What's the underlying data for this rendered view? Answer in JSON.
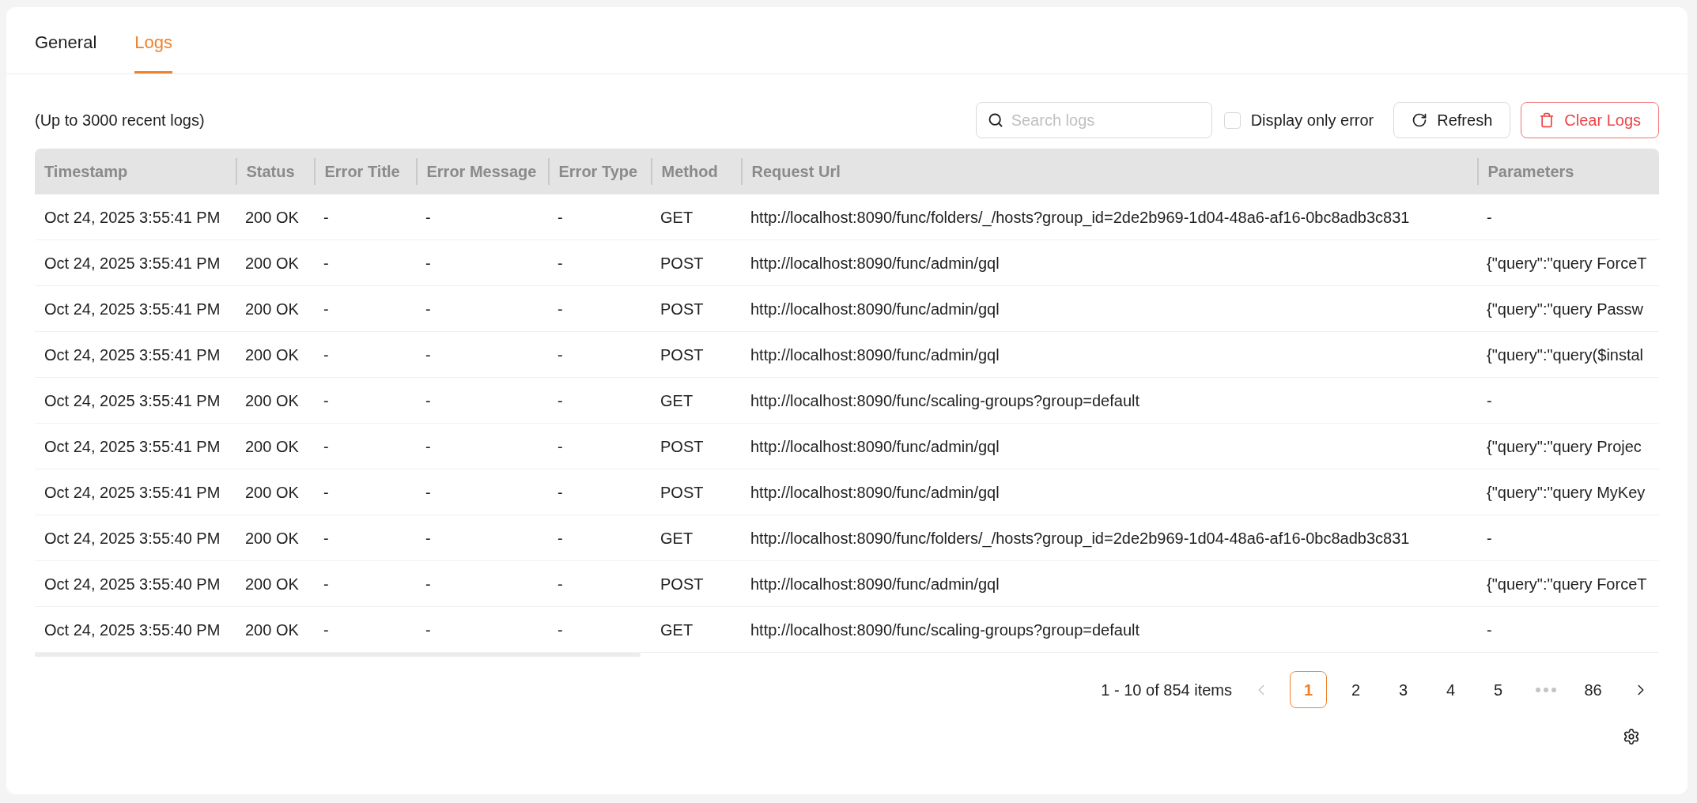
{
  "tabs": [
    {
      "label": "General",
      "selected": false
    },
    {
      "label": "Logs",
      "selected": true
    }
  ],
  "toolbar": {
    "note": "(Up to 3000 recent logs)",
    "search": {
      "placeholder": "Search logs"
    },
    "error_filter": {
      "label": "Display only error",
      "checked": false
    },
    "buttons": [
      {
        "kind": "refresh",
        "label": "Refresh"
      },
      {
        "kind": "clear",
        "label": "Clear Logs"
      }
    ]
  },
  "table": {
    "columns": [
      "Timestamp",
      "Status",
      "Error Title",
      "Error Message",
      "Error Type",
      "Method",
      "Request Url",
      "Parameters"
    ],
    "rows": [
      [
        "Oct 24, 2025 3:55:41 PM",
        "200 OK",
        "-",
        "-",
        "-",
        "GET",
        "http://localhost:8090/func/folders/_/hosts?group_id=2de2b969-1d04-48a6-af16-0bc8adb3c831",
        "-"
      ],
      [
        "Oct 24, 2025 3:55:41 PM",
        "200 OK",
        "-",
        "-",
        "-",
        "POST",
        "http://localhost:8090/func/admin/gql",
        "{\"query\":\"query ForceT"
      ],
      [
        "Oct 24, 2025 3:55:41 PM",
        "200 OK",
        "-",
        "-",
        "-",
        "POST",
        "http://localhost:8090/func/admin/gql",
        "{\"query\":\"query Passw"
      ],
      [
        "Oct 24, 2025 3:55:41 PM",
        "200 OK",
        "-",
        "-",
        "-",
        "POST",
        "http://localhost:8090/func/admin/gql",
        "{\"query\":\"query($instal"
      ],
      [
        "Oct 24, 2025 3:55:41 PM",
        "200 OK",
        "-",
        "-",
        "-",
        "GET",
        "http://localhost:8090/func/scaling-groups?group=default",
        "-"
      ],
      [
        "Oct 24, 2025 3:55:41 PM",
        "200 OK",
        "-",
        "-",
        "-",
        "POST",
        "http://localhost:8090/func/admin/gql",
        "{\"query\":\"query Projec"
      ],
      [
        "Oct 24, 2025 3:55:41 PM",
        "200 OK",
        "-",
        "-",
        "-",
        "POST",
        "http://localhost:8090/func/admin/gql",
        "{\"query\":\"query MyKey"
      ],
      [
        "Oct 24, 2025 3:55:40 PM",
        "200 OK",
        "-",
        "-",
        "-",
        "GET",
        "http://localhost:8090/func/folders/_/hosts?group_id=2de2b969-1d04-48a6-af16-0bc8adb3c831",
        "-"
      ],
      [
        "Oct 24, 2025 3:55:40 PM",
        "200 OK",
        "-",
        "-",
        "-",
        "POST",
        "http://localhost:8090/func/admin/gql",
        "{\"query\":\"query ForceT"
      ],
      [
        "Oct 24, 2025 3:55:40 PM",
        "200 OK",
        "-",
        "-",
        "-",
        "GET",
        "http://localhost:8090/func/scaling-groups?group=default",
        "-"
      ]
    ]
  },
  "pagination": {
    "summary": "1 - 10 of 854 items",
    "prev": {
      "disabled": true
    },
    "next": {
      "disabled": false
    },
    "pages": [
      {
        "kind": "page",
        "label": "1",
        "selected": true
      },
      {
        "kind": "page",
        "label": "2",
        "selected": false
      },
      {
        "kind": "page",
        "label": "3",
        "selected": false
      },
      {
        "kind": "page",
        "label": "4",
        "selected": false
      },
      {
        "kind": "page",
        "label": "5",
        "selected": false
      },
      {
        "kind": "ellipsis",
        "selected": false
      },
      {
        "kind": "page",
        "label": "86",
        "selected": false
      }
    ]
  }
}
